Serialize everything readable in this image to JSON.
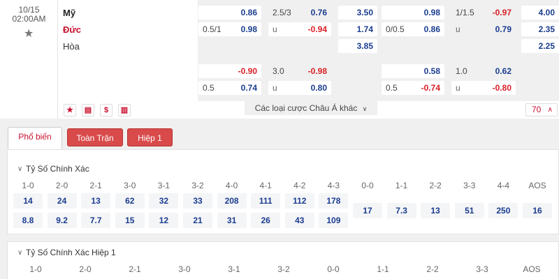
{
  "match": {
    "date": "10/15",
    "time": "02:00AM",
    "team_home": "Mỹ",
    "team_away": "Đức",
    "draw": "Hòa"
  },
  "odds_full": {
    "row1": {
      "ah_home": "0.86",
      "ou_line": "2.5/3",
      "ou_over": "0.76",
      "x12_home": "3.50"
    },
    "row2": {
      "ah_line": "0.5/1",
      "ah_away": "0.98",
      "ou_u": "u",
      "ou_under": "-0.94",
      "x12_away": "1.74"
    },
    "row3": {
      "x12_draw": "3.85"
    },
    "row4": {
      "ah_home": "-0.90",
      "ou_line": "3.0",
      "ou_over": "-0.98"
    },
    "row5": {
      "ah_line": "0.5",
      "ah_away": "0.74",
      "ou_u": "u",
      "ou_under": "0.80"
    }
  },
  "odds_half": {
    "row1": {
      "ah_home": "0.98",
      "ou_line": "1/1.5",
      "ou_over": "-0.97",
      "x12_home": "4.00"
    },
    "row2": {
      "ah_line": "0/0.5",
      "ah_away": "0.86",
      "ou_u": "u",
      "ou_under": "0.79",
      "x12_away": "2.35"
    },
    "row3": {
      "x12_draw": "2.25"
    },
    "row4": {
      "ah_home": "0.58",
      "ou_line": "1.0",
      "ou_over": "0.62"
    },
    "row5": {
      "ah_line": "0.5",
      "ah_away": "-0.74",
      "ou_u": "u",
      "ou_under": "-0.80"
    }
  },
  "actions": {
    "star": "★",
    "ticket": "▤",
    "dollar": "$",
    "chart": "▥"
  },
  "more_asian": "Các loại cược Châu Á khác",
  "more_count": "70",
  "tabs": [
    "Phổ biến",
    "Toàn Trận",
    "Hiệp 1"
  ],
  "exact_score": {
    "title": "Tỷ Số Chính Xác",
    "labels": [
      "1-0",
      "2-0",
      "2-1",
      "3-0",
      "3-1",
      "3-2",
      "4-0",
      "4-1",
      "4-2",
      "4-3",
      "0-0",
      "1-1",
      "2-2",
      "3-3",
      "4-4",
      "AOS"
    ],
    "home_odds": [
      "14",
      "24",
      "13",
      "62",
      "32",
      "33",
      "208",
      "111",
      "112",
      "178"
    ],
    "away_odds": [
      "8.8",
      "9.2",
      "7.7",
      "15",
      "12",
      "21",
      "31",
      "26",
      "43",
      "109"
    ],
    "draw_odds": [
      "17",
      "7.3",
      "13",
      "51",
      "250",
      "16"
    ]
  },
  "exact_score_half": {
    "title": "Tỷ Số Chính Xác Hiệp 1",
    "labels": [
      "1-0",
      "2-0",
      "2-1",
      "3-0",
      "3-1",
      "3-2",
      "0-0",
      "1-1",
      "2-2",
      "3-3",
      "AOS"
    ]
  }
}
